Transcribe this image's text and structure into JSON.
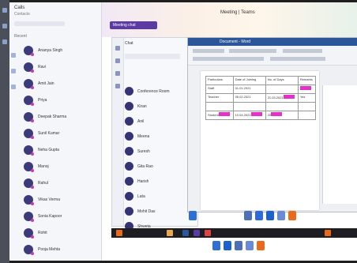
{
  "left_panel": {
    "header_title": "Calls",
    "header_sub": "Contacts",
    "section_label": "Recent",
    "contacts": [
      "Ananya Singh",
      "Ravi",
      "Amit Jain",
      "Priya",
      "Deepak Sharma",
      "Sunil Kumar",
      "Neha Gupta",
      "Manoj",
      "Rahul",
      "Vikas Verma",
      "Sonia Kapoor",
      "Rohit",
      "Pooja Mehta"
    ]
  },
  "main": {
    "window_title": "Meeting  |  Teams",
    "chip_label": "Meeting chat",
    "chat": {
      "header": "Chat",
      "items": [
        "Conference Room",
        "Kiran",
        "Anil",
        "Meena",
        "Suresh",
        "Gita Rao",
        "Harish",
        "Lata",
        "Mohit Das",
        "Shweta"
      ]
    },
    "doc": {
      "title": "Document - Word",
      "table_headers": [
        "Particulars",
        "Date of Joining",
        "No. of Days",
        "Remarks"
      ],
      "rows": [
        [
          "Staff",
          "01.01.2021",
          "",
          ""
        ],
        [
          "Teacher",
          "05.02.2021",
          "21.03.2021",
          "Yes"
        ],
        [
          "",
          "",
          "",
          ""
        ],
        [
          "Student",
          "10.04.2021",
          "20",
          ""
        ]
      ]
    }
  },
  "colors": {
    "accent": "#5c3aa6",
    "highlight": "#e432c8",
    "word_blue": "#2b579a"
  }
}
